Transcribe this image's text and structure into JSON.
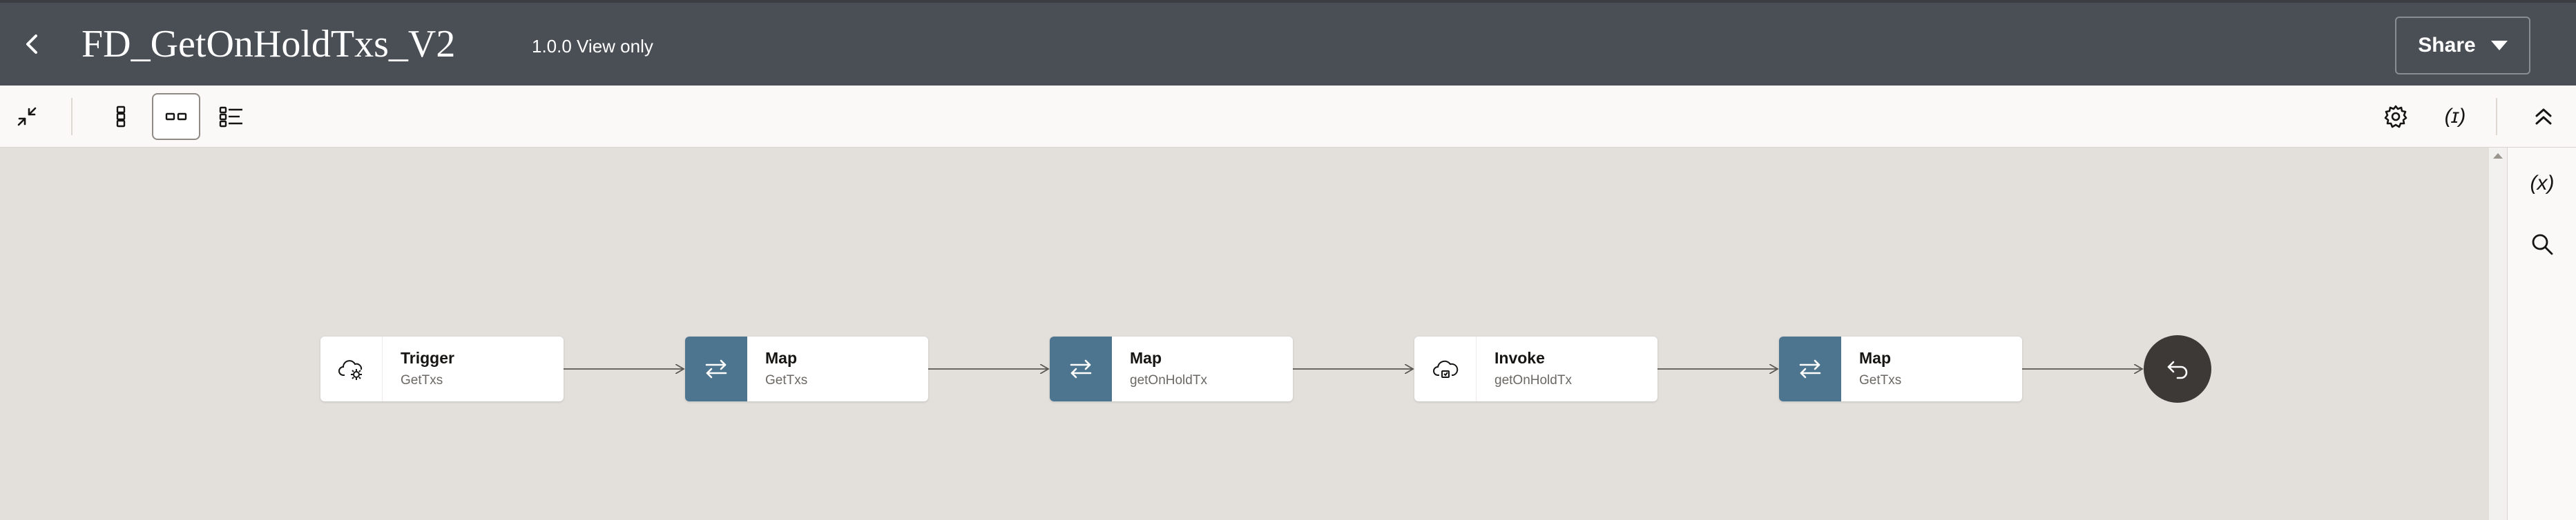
{
  "header": {
    "title": "FD_GetOnHoldTxs_V2",
    "version_label": "1.0.0 View only",
    "share_label": "Share",
    "back_icon": "chevron-left-icon"
  },
  "toolbar": {
    "left_buttons": [
      {
        "name": "collapse-icon",
        "active": false
      },
      {
        "name": "vertical-layout-icon",
        "active": false
      },
      {
        "name": "horizontal-layout-icon",
        "active": true
      },
      {
        "name": "pseudo-view-icon",
        "active": false
      }
    ],
    "right_buttons": [
      {
        "name": "gear-icon"
      },
      {
        "name": "variable-icon",
        "glyph": "(ɪ)"
      },
      {
        "name": "double-chevron-up-icon"
      }
    ]
  },
  "right_panel": {
    "variables_glyph": "(x)",
    "search_icon": "search-icon"
  },
  "flow": {
    "nodes": [
      {
        "type": "trigger",
        "title": "Trigger",
        "subtitle": "GetTxs",
        "icon": "cloud-gear-icon"
      },
      {
        "type": "map",
        "title": "Map",
        "subtitle": "GetTxs",
        "icon": "swap-arrows-icon"
      },
      {
        "type": "map",
        "title": "Map",
        "subtitle": "getOnHoldTx",
        "icon": "swap-arrows-icon"
      },
      {
        "type": "invoke",
        "title": "Invoke",
        "subtitle": "getOnHoldTx",
        "icon": "cloud-invoke-icon"
      },
      {
        "type": "map",
        "title": "Map",
        "subtitle": "GetTxs",
        "icon": "swap-arrows-icon"
      }
    ],
    "end_icon": "return-arrow-icon"
  },
  "colors": {
    "header_bg": "#4a4f55",
    "toolbar_bg": "#fbf9f8",
    "canvas_bg": "#e3e0dc",
    "map_icon_bg": "#4e7590",
    "end_node_bg": "#3d3936"
  }
}
